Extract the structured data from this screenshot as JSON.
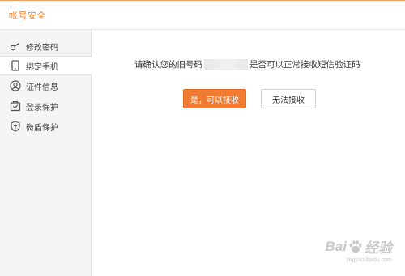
{
  "header": {
    "title": "帐号安全"
  },
  "sidebar": {
    "items": [
      {
        "label": "修改密码",
        "icon": "key-icon"
      },
      {
        "label": "绑定手机",
        "icon": "phone-icon",
        "active": true
      },
      {
        "label": "证件信息",
        "icon": "id-user-icon"
      },
      {
        "label": "登录保护",
        "icon": "login-protect-icon"
      },
      {
        "label": "微盾保护",
        "icon": "shield-icon"
      }
    ]
  },
  "main": {
    "prompt_before": "请确认您的旧号码",
    "prompt_after": "是否可以正常接收短信验证码",
    "confirm_label": "是，可以接收",
    "reject_label": "无法接收"
  },
  "watermark": {
    "left": "Bai",
    "right": "经验",
    "sub": "jingyan.baidu.com"
  },
  "colors": {
    "accent": "#f07c34",
    "title": "#e8782a",
    "sidebar_bg": "#f5f5f5"
  }
}
